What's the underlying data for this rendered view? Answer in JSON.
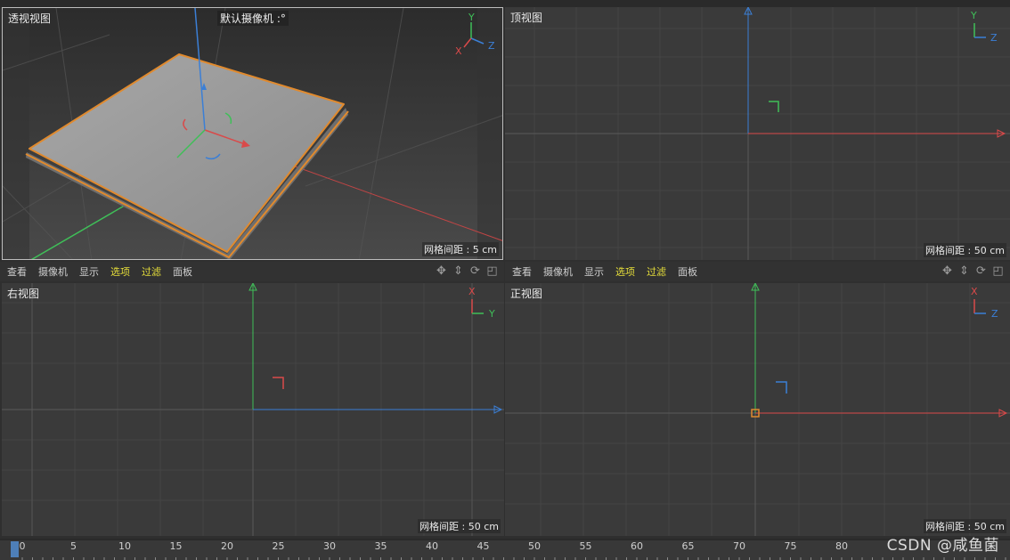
{
  "viewports": {
    "perspective": {
      "title": "透视视图",
      "camera": "默认摄像机 :°",
      "grid": "网格间距 : 5 cm"
    },
    "top": {
      "title": "顶视图",
      "grid": "网格间距 : 50 cm"
    },
    "right": {
      "title": "右视图",
      "grid": "网格间距 : 50 cm"
    },
    "front": {
      "title": "正视图",
      "grid": "网格间距 : 50 cm"
    }
  },
  "toolbar": {
    "items": [
      "查看",
      "摄像机",
      "显示",
      "选项",
      "过滤",
      "面板"
    ],
    "highlighted": [
      "选项",
      "过滤"
    ]
  },
  "axis_labels": {
    "x": "X",
    "y": "Y",
    "z": "Z"
  },
  "timeline": {
    "ticks": [
      "0",
      "5",
      "10",
      "15",
      "20",
      "25",
      "30",
      "35",
      "40",
      "45",
      "50",
      "55",
      "60",
      "65",
      "70",
      "75",
      "80"
    ]
  },
  "watermark": "CSDN @咸鱼菌",
  "colors": {
    "x_axis": "#d94a4a",
    "y_axis": "#3fbf58",
    "z_axis": "#3b7fd6",
    "highlight": "#e6de3a",
    "selection": "#e08a2e"
  }
}
